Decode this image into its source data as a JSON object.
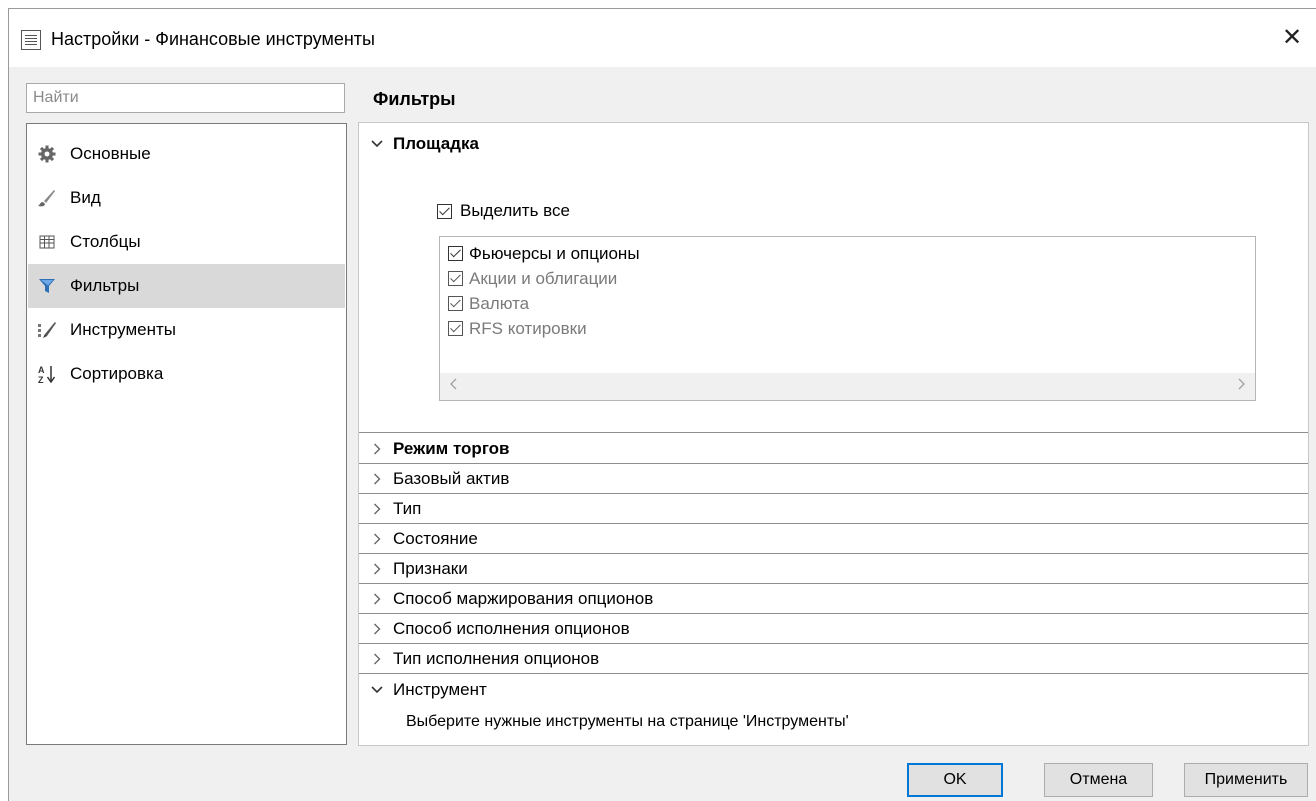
{
  "window": {
    "title": "Настройки - Финансовые инструменты",
    "close_glyph": "✕"
  },
  "search": {
    "placeholder": "Найти",
    "value": ""
  },
  "sidebar": {
    "items": [
      {
        "label": "Основные",
        "icon": "gear-icon"
      },
      {
        "label": "Вид",
        "icon": "brush-icon"
      },
      {
        "label": "Столбцы",
        "icon": "table-icon"
      },
      {
        "label": "Фильтры",
        "icon": "filter-icon",
        "active": true
      },
      {
        "label": "Инструменты",
        "icon": "instruments-icon"
      },
      {
        "label": "Сортировка",
        "icon": "sort-az-icon"
      }
    ]
  },
  "page": {
    "title": "Фильтры"
  },
  "sections": {
    "venue": {
      "label": "Площадка",
      "expanded": true,
      "select_all": {
        "label": "Выделить все",
        "checked": true
      },
      "items": [
        {
          "label": "Фьючерсы и опционы",
          "checked": true,
          "enabled": true
        },
        {
          "label": "Акции и облигации",
          "checked": true,
          "enabled": false
        },
        {
          "label": "Валюта",
          "checked": true,
          "enabled": false
        },
        {
          "label": "RFS котировки",
          "checked": true,
          "enabled": false
        }
      ]
    },
    "collapsed": [
      {
        "label": "Режим торгов",
        "bold": true
      },
      {
        "label": "Базовый актив"
      },
      {
        "label": "Тип"
      },
      {
        "label": "Состояние"
      },
      {
        "label": "Признаки"
      },
      {
        "label": "Способ маржирования опционов"
      },
      {
        "label": "Способ исполнения опционов"
      },
      {
        "label": "Тип исполнения опционов"
      }
    ],
    "instrument": {
      "label": "Инструмент",
      "expanded": true,
      "hint": "Выберите нужные инструменты на странице 'Инструменты'"
    }
  },
  "buttons": {
    "ok": "OK",
    "cancel": "Отмена",
    "apply": "Применить"
  },
  "colors": {
    "default_button_border": "#0078d7",
    "active_sidebar_bg": "#d9d9d9",
    "disabled_text": "#7a7a7a"
  }
}
